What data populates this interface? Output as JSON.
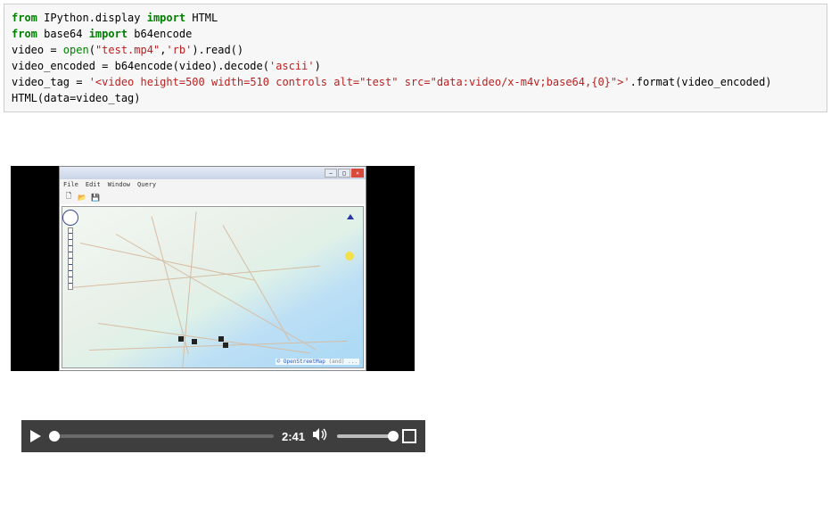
{
  "code": {
    "l1_from": "from",
    "l1_mod": " IPython.display ",
    "l1_import": "import",
    "l1_name": " HTML",
    "l2_from": "from",
    "l2_mod": " base64 ",
    "l2_import": "import",
    "l2_name": " b64encode",
    "l3_pre": "video = ",
    "l3_open": "open",
    "l3_args1": "(",
    "l3_str1": "\"test.mp4\"",
    "l3_comma": ",",
    "l3_str2": "'rb'",
    "l3_post": ").read()",
    "l4_pre": "video_encoded = b64encode(video).decode(",
    "l4_str": "'ascii'",
    "l4_post": ")",
    "l5_pre": "video_tag = ",
    "l5_str": "'<video height=500 width=510 controls alt=\"test\" src=\"data:video/x-m4v;base64,{0}\">'",
    "l5_post": ".format(video_encoded)",
    "l6": "HTML(data=video_tag)"
  },
  "window": {
    "title": "",
    "menu": {
      "file": "File",
      "edit": "Edit",
      "window": "Window",
      "query": "Query"
    },
    "attribution_link": "OpenStreetMap",
    "attribution_suffix": " (and) ..."
  },
  "player": {
    "time": "2:41"
  }
}
